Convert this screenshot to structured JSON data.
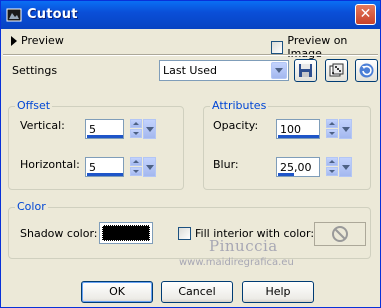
{
  "window": {
    "title": "Cutout",
    "close_label": "✕"
  },
  "preview": {
    "toggle_label": "Preview",
    "on_image_label": "Preview on Image",
    "on_image_checked": false
  },
  "settings": {
    "label": "Settings",
    "selected": "Last Used"
  },
  "offset": {
    "title": "Offset",
    "vertical_label": "Vertical:",
    "vertical_value": "5",
    "horizontal_label": "Horizontal:",
    "horizontal_value": "5"
  },
  "attributes": {
    "title": "Attributes",
    "opacity_label": "Opacity:",
    "opacity_value": "100",
    "blur_label": "Blur:",
    "blur_value": "25,00"
  },
  "color": {
    "title": "Color",
    "shadow_label": "Shadow color:",
    "shadow_color": "#000000",
    "fill_label": "Fill interior with color:",
    "fill_checked": false
  },
  "watermark": {
    "name": "Pinuccia",
    "url": "www.maidiregrafica.eu"
  },
  "buttons": {
    "ok": "OK",
    "cancel": "Cancel",
    "help": "Help"
  },
  "colors": {
    "titlebar": "#0a4fd8",
    "group_title": "#0046d5",
    "background": "#ece9d8"
  }
}
